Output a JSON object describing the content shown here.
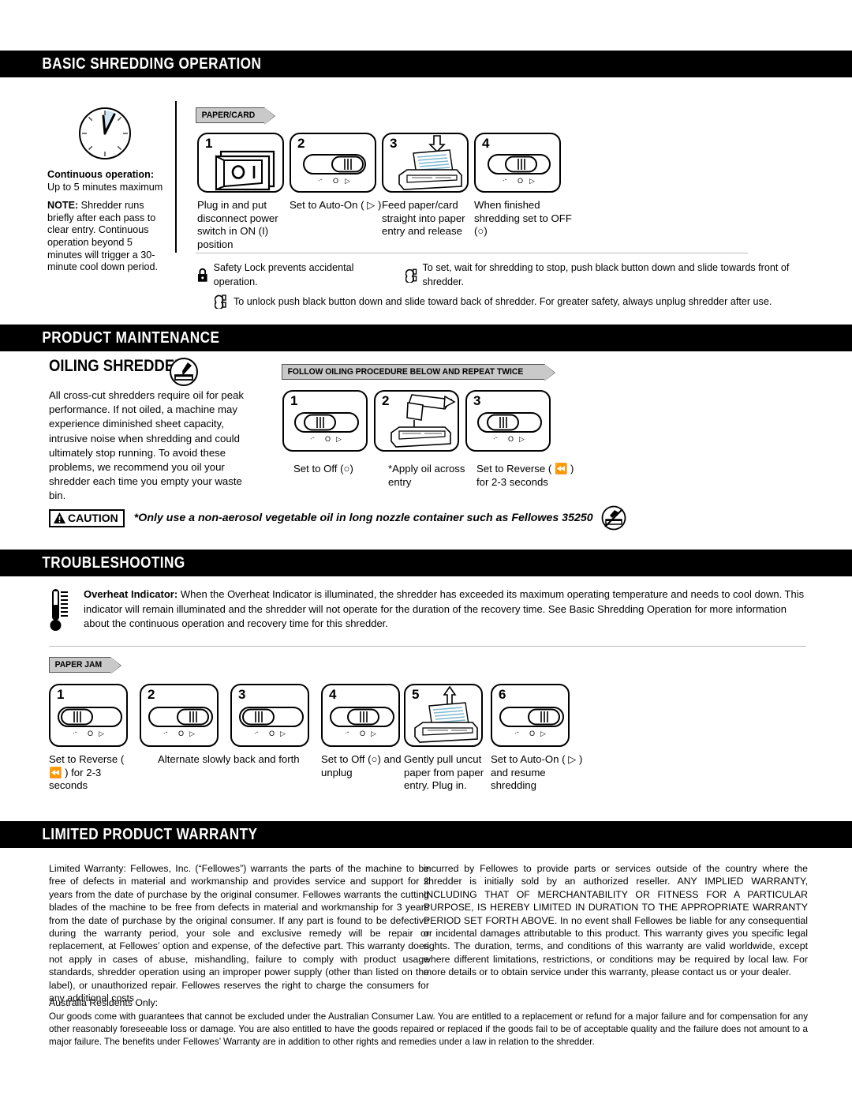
{
  "sections": {
    "basic": {
      "title": "BASIC SHREDDING OPERATION"
    },
    "maintenance": {
      "title": "PRODUCT MAINTENANCE"
    },
    "troubleshooting": {
      "title": "TROUBLESHOOTING"
    },
    "warranty": {
      "title": "LIMITED PRODUCT WARRANTY"
    }
  },
  "basic": {
    "clock_icon": "clock-icon",
    "continuous_heading": "Continuous operation:",
    "continuous_value": "Up to 5 minutes maximum",
    "note_label": "NOTE:",
    "note_text": " Shredder runs briefly after each pass to clear entry. Continuous operation beyond 5 minutes will trigger a 30-minute cool down period.",
    "ribbon": "PAPER/CARD",
    "steps": [
      {
        "num": "1",
        "icon": "power-switch-icon",
        "label": "Plug in and put disconnect power switch in ON (I) position"
      },
      {
        "num": "2",
        "icon": "slide-switch-icon",
        "label": "Set to Auto-On ( ▷ )"
      },
      {
        "num": "3",
        "icon": "feed-paper-icon",
        "label": "Feed paper/card straight into paper entry and release"
      },
      {
        "num": "4",
        "icon": "slide-switch-icon",
        "label": "When finished shredding set to OFF (○)"
      }
    ],
    "safety": [
      {
        "icon": "padlock-closed-icon",
        "text": "Safety Lock prevents accidental operation.",
        "icon2": "padlock-open-icon",
        "text2": "To set, wait for shredding to stop, push black button down and slide towards front of shredder."
      },
      {
        "icon": "padlock-open-icon",
        "text": "To unlock push black button down and slide toward back of shredder. For greater safety, always unplug shredder after use."
      }
    ]
  },
  "oiling": {
    "title": "OILING SHREDDER",
    "icon": "oil-bottle-icon",
    "body": "All cross-cut shredders require oil for peak performance. If not oiled, a machine may experience diminished sheet capacity, intrusive noise when shredding and could ultimately stop running. To avoid these problems, we recommend you oil your shredder each time you empty your waste bin.",
    "ribbon": "FOLLOW OILING PROCEDURE BELOW AND REPEAT TWICE",
    "steps": [
      {
        "num": "1",
        "icon": "slide-switch-icon",
        "label": "Set to Off (○)"
      },
      {
        "num": "2",
        "icon": "apply-oil-icon",
        "label": "*Apply oil across entry"
      },
      {
        "num": "3",
        "icon": "slide-switch-icon",
        "label": "Set to Reverse ( ⏪ ) for 2-3 seconds"
      }
    ],
    "caution": {
      "badge": "CAUTION",
      "warning_icon": "warning-triangle-icon",
      "text": "*Only use a non-aerosol vegetable oil in long nozzle container such as Fellowes 35250",
      "no_aerosol_icon": "no-aerosol-icon"
    }
  },
  "troubleshooting": {
    "thermometer_icon": "thermometer-icon",
    "overheat_label": "Overheat Indicator:",
    "overheat_text": "  When the Overheat Indicator is illuminated, the shredder has exceeded its maximum operating temperature and needs to cool down. This indicator will remain illuminated and the shredder will not operate for the duration of the recovery time. See Basic Shredding Operation for more information about the continuous operation and recovery time for this shredder.",
    "ribbon": "PAPER JAM",
    "steps": [
      {
        "num": "1",
        "icon": "slide-switch-icon",
        "label": "Set to Reverse ( ⏪ ) for 2-3 seconds"
      },
      {
        "num": "2",
        "icon": "slide-switch-icon",
        "label": "Alternate slowly back and forth"
      },
      {
        "num": "3",
        "icon": "slide-switch-icon",
        "label": ""
      },
      {
        "num": "4",
        "icon": "slide-switch-icon",
        "label": "Set to Off (○) and unplug"
      },
      {
        "num": "5",
        "icon": "pull-paper-icon",
        "label": "Gently pull uncut paper from paper entry. Plug in."
      },
      {
        "num": "6",
        "icon": "slide-switch-icon",
        "label": "Set to Auto-On ( ▷ ) and resume shredding"
      }
    ]
  },
  "warranty": {
    "col_left": "Limited Warranty:  Fellowes, Inc. (“Fellowes”) warrants the parts of the machine to be free of defects in material and workmanship and provides service and support for 2 years from the date of purchase by the original consumer.  Fellowes warrants the cutting blades of the machine to be free from defects in material and workmanship for 3 years from the date of purchase by the original consumer. If any part is found to be defective during the warranty period, your sole and exclusive remedy will be repair or replacement, at Fellowes’ option and expense, of the defective part. This warranty does not apply in cases of abuse, mishandling, failure to comply with product usage standards, shredder operation using an improper power supply (other than listed on the label), or unauthorized repair. Fellowes reserves the right to charge the consumers for any additional costs",
    "col_right": "incurred by Fellowes to provide parts or services outside of the country where the shredder is initially sold by an authorized reseller. ANY IMPLIED WARRANTY, INCLUDING THAT OF MERCHANTABILITY OR FITNESS FOR A PARTICULAR PURPOSE, IS HEREBY LIMITED IN DURATION TO THE APPROPRIATE WARRANTY PERIOD SET FORTH ABOVE. In no event shall Fellowes be liable for any consequential or incidental damages attributable to this product. This warranty gives you specific legal rights. The duration, terms, and conditions of this warranty are valid worldwide, except where different limitations, restrictions, or conditions may be required by local law. For more details or to obtain service under this warranty, please contact us or your dealer.",
    "australia_heading": "Australia Residents Only:",
    "australia_text": "Our goods come with guarantees that cannot be excluded under the Australian Consumer Law. You are entitled to a replacement or refund for a major failure and for compensation for any other reasonably foreseeable loss or damage. You are also entitled to have the goods repaired or replaced if the goods fail to be of acceptable quality and the failure does not amount to a major failure.  The benefits under Fellowes’ Warranty are in addition to other rights and remedies under a law in relation to the shredder."
  },
  "switch_marks": {
    "reverse": "ᐧᐨ",
    "off": "O",
    "forward": "▷"
  },
  "colors": {
    "band": "#000000",
    "ribbon_fill": "#c9c9c9",
    "ribbon_stroke": "#555555",
    "paper_tint": "#cfe4ee"
  }
}
